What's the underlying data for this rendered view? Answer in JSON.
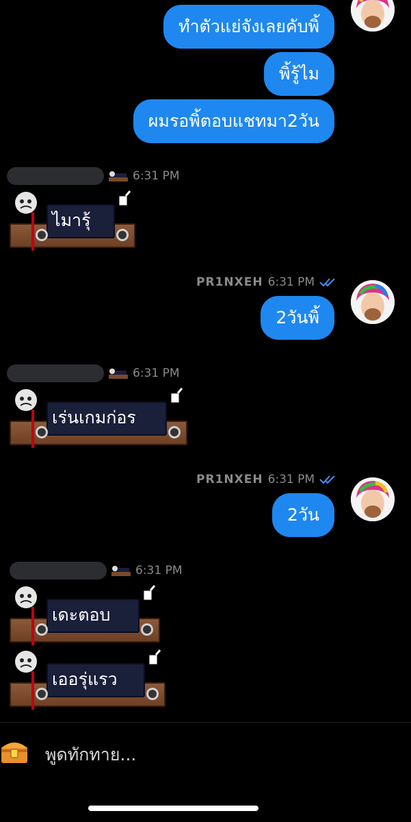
{
  "messages_out_top": [
    {
      "text": "ทำตัวแย่จังเลยคับพิ้"
    },
    {
      "text": "พิ้รู้ไม"
    },
    {
      "text": "ผมรอพิ้ตอบแชทมา2วัน"
    }
  ],
  "incoming_1": {
    "time": "6:31 PM",
    "text": "ไมารุ้"
  },
  "outgoing_1": {
    "sender": "PR1NXEH",
    "time": "6:31 PM",
    "text": "2วันพิ้"
  },
  "incoming_2": {
    "time": "6:31 PM",
    "text": "เร่นเกมก่อร"
  },
  "outgoing_2": {
    "sender": "PR1NXEH",
    "time": "6:31 PM",
    "text": "2วัน"
  },
  "incoming_3": {
    "time": "6:31 PM",
    "texts": [
      "เดะตอบ",
      "เออรุ่แรว"
    ]
  },
  "composer": {
    "placeholder": "พูดทักทาย..."
  },
  "colors": {
    "bubble_out": "#1e88f0",
    "read_check": "#4a8ef0",
    "meta": "#8a8a8a"
  }
}
